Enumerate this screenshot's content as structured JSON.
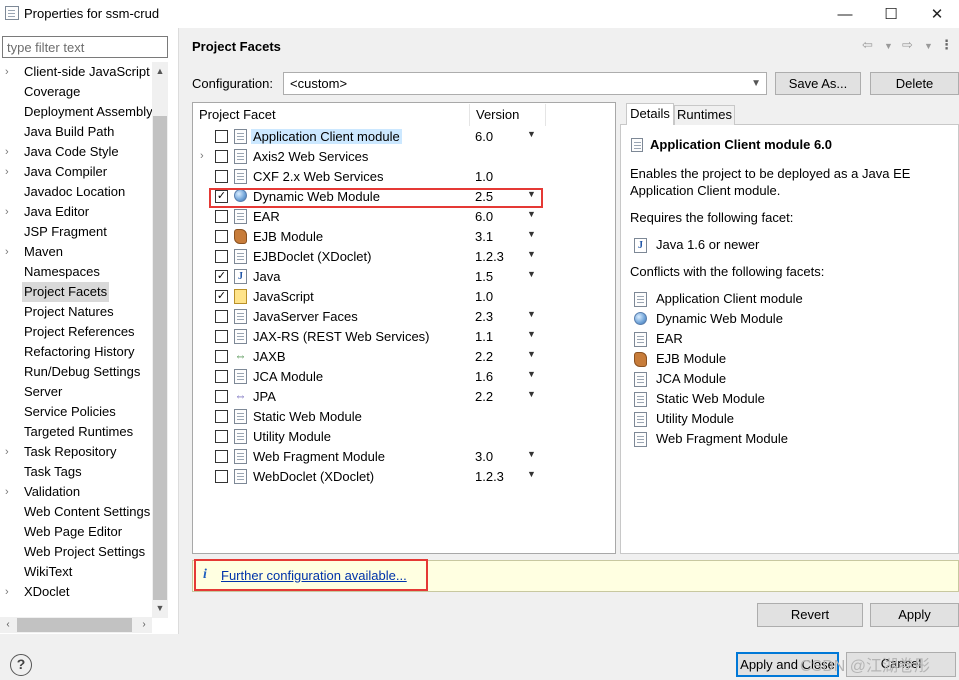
{
  "window": {
    "title": "Properties for ssm-crud",
    "minimize_glyph": "—",
    "maximize_glyph": "☐",
    "close_glyph": "✕"
  },
  "filter": {
    "placeholder": "type filter text",
    "value": ""
  },
  "nav": {
    "items": [
      {
        "label": "Client-side JavaScript",
        "expandable": true
      },
      {
        "label": "Coverage",
        "expandable": false
      },
      {
        "label": "Deployment Assembly",
        "expandable": false
      },
      {
        "label": "Java Build Path",
        "expandable": false
      },
      {
        "label": "Java Code Style",
        "expandable": true
      },
      {
        "label": "Java Compiler",
        "expandable": true
      },
      {
        "label": "Javadoc Location",
        "expandable": false
      },
      {
        "label": "Java Editor",
        "expandable": true
      },
      {
        "label": "JSP Fragment",
        "expandable": false
      },
      {
        "label": "Maven",
        "expandable": true
      },
      {
        "label": "Namespaces",
        "expandable": false
      },
      {
        "label": "Project Facets",
        "expandable": false,
        "selected": true
      },
      {
        "label": "Project Natures",
        "expandable": false
      },
      {
        "label": "Project References",
        "expandable": false
      },
      {
        "label": "Refactoring History",
        "expandable": false
      },
      {
        "label": "Run/Debug Settings",
        "expandable": false
      },
      {
        "label": "Server",
        "expandable": false
      },
      {
        "label": "Service Policies",
        "expandable": false
      },
      {
        "label": "Targeted Runtimes",
        "expandable": false
      },
      {
        "label": "Task Repository",
        "expandable": true
      },
      {
        "label": "Task Tags",
        "expandable": false
      },
      {
        "label": "Validation",
        "expandable": true
      },
      {
        "label": "Web Content Settings",
        "expandable": false
      },
      {
        "label": "Web Page Editor",
        "expandable": false
      },
      {
        "label": "Web Project Settings",
        "expandable": false
      },
      {
        "label": "WikiText",
        "expandable": false
      },
      {
        "label": "XDoclet",
        "expandable": true
      }
    ]
  },
  "page": {
    "title": "Project Facets",
    "config_label": "Configuration:",
    "config_value": "<custom>",
    "save_as_label": "Save As...",
    "delete_label": "Delete"
  },
  "facets": {
    "col_facet": "Project Facet",
    "col_version": "Version",
    "rows": [
      {
        "name": "Application Client module",
        "version": "6.0",
        "checked": false,
        "icon": "page-icon",
        "dropdown": true,
        "selected": true,
        "expandable": false
      },
      {
        "name": "Axis2 Web Services",
        "version": "",
        "checked": false,
        "icon": "page-icon",
        "dropdown": false,
        "expandable": true
      },
      {
        "name": "CXF 2.x Web Services",
        "version": "1.0",
        "checked": false,
        "icon": "page-icon",
        "dropdown": false,
        "expandable": false
      },
      {
        "name": "Dynamic Web Module",
        "version": "2.5",
        "checked": true,
        "icon": "globe-icon",
        "dropdown": true,
        "expandable": false
      },
      {
        "name": "EAR",
        "version": "6.0",
        "checked": false,
        "icon": "page-icon",
        "dropdown": true,
        "expandable": false
      },
      {
        "name": "EJB Module",
        "version": "3.1",
        "checked": false,
        "icon": "bean-icon",
        "dropdown": true,
        "expandable": false
      },
      {
        "name": "EJBDoclet (XDoclet)",
        "version": "1.2.3",
        "checked": false,
        "icon": "page-icon",
        "dropdown": true,
        "expandable": false
      },
      {
        "name": "Java",
        "version": "1.5",
        "checked": true,
        "icon": "java-icon",
        "dropdown": true,
        "expandable": false
      },
      {
        "name": "JavaScript",
        "version": "1.0",
        "checked": true,
        "icon": "js-icon",
        "dropdown": false,
        "expandable": false
      },
      {
        "name": "JavaServer Faces",
        "version": "2.3",
        "checked": false,
        "icon": "page-icon",
        "dropdown": true,
        "expandable": false
      },
      {
        "name": "JAX-RS (REST Web Services)",
        "version": "1.1",
        "checked": false,
        "icon": "page-icon",
        "dropdown": true,
        "expandable": false
      },
      {
        "name": "JAXB",
        "version": "2.2",
        "checked": false,
        "icon": "jaxb-icon",
        "dropdown": true,
        "expandable": false
      },
      {
        "name": "JCA Module",
        "version": "1.6",
        "checked": false,
        "icon": "page-icon",
        "dropdown": true,
        "expandable": false
      },
      {
        "name": "JPA",
        "version": "2.2",
        "checked": false,
        "icon": "jpa-icon",
        "dropdown": true,
        "expandable": false
      },
      {
        "name": "Static Web Module",
        "version": "",
        "checked": false,
        "icon": "page-icon",
        "dropdown": false,
        "expandable": false
      },
      {
        "name": "Utility Module",
        "version": "",
        "checked": false,
        "icon": "page-icon",
        "dropdown": false,
        "expandable": false
      },
      {
        "name": "Web Fragment Module",
        "version": "3.0",
        "checked": false,
        "icon": "page-icon",
        "dropdown": true,
        "expandable": false
      },
      {
        "name": "WebDoclet (XDoclet)",
        "version": "1.2.3",
        "checked": false,
        "icon": "page-icon",
        "dropdown": true,
        "expandable": false
      }
    ]
  },
  "details": {
    "tab_details": "Details",
    "tab_runtimes": "Runtimes",
    "title": "Application Client module 6.0",
    "desc_line1": "Enables the project to be deployed as a Java EE",
    "desc_line2": "Application Client module.",
    "requires_label": "Requires the following facet:",
    "requires": [
      {
        "label": "Java 1.6 or newer",
        "icon": "java-icon"
      }
    ],
    "conflicts_label": "Conflicts with the following facets:",
    "conflicts": [
      {
        "label": "Application Client module",
        "icon": "page-icon"
      },
      {
        "label": "Dynamic Web Module",
        "icon": "globe-icon"
      },
      {
        "label": "EAR",
        "icon": "page-icon"
      },
      {
        "label": "EJB Module",
        "icon": "bean-icon"
      },
      {
        "label": "JCA Module",
        "icon": "page-icon"
      },
      {
        "label": "Static Web Module",
        "icon": "page-icon"
      },
      {
        "label": "Utility Module",
        "icon": "page-icon"
      },
      {
        "label": "Web Fragment Module",
        "icon": "page-icon"
      }
    ]
  },
  "info": {
    "icon_glyph": "i",
    "link_text": "Further configuration available..."
  },
  "buttons": {
    "revert": "Revert",
    "apply": "Apply",
    "apply_close": "Apply and Close",
    "cancel": "Cancel",
    "help_glyph": "?"
  },
  "watermark": "CSDN @江湖卷彤",
  "colors": {
    "highlight_border": "#e53935",
    "info_bar_bg": "#ffffe1",
    "link": "#0033aa",
    "selected_row": "#cce8ff"
  }
}
